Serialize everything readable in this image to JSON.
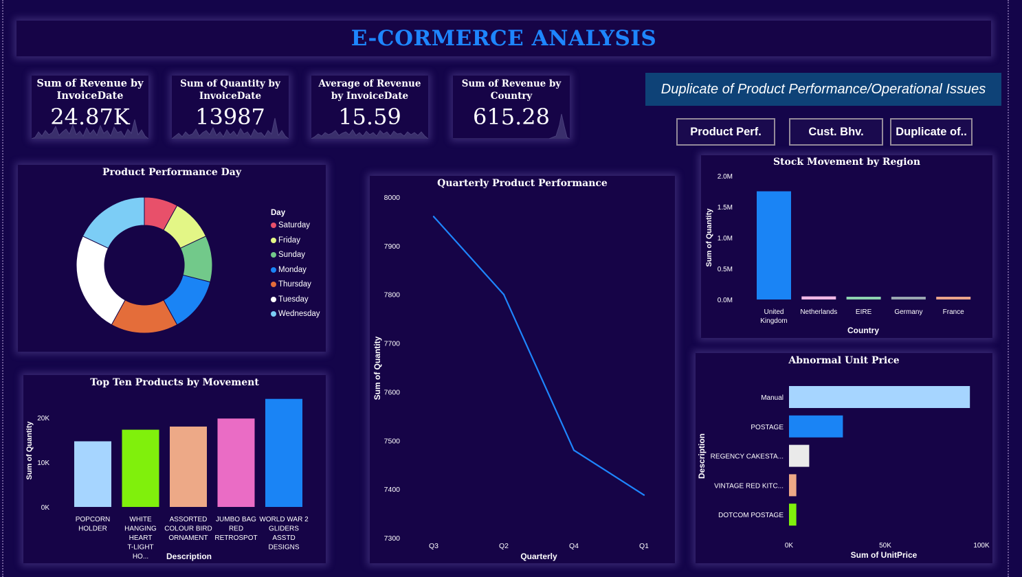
{
  "header": {
    "title": "E-CORMERCE ANALYSIS"
  },
  "kpis": [
    {
      "label": "Sum of Revenue by InvoiceDate",
      "value": "24.87K"
    },
    {
      "label": "Sum of Quantity by InvoiceDate",
      "value": "13987"
    },
    {
      "label": "Average of Revenue by InvoiceDate",
      "value": "15.59"
    },
    {
      "label": "Sum of Revenue by Country",
      "value": "615.28"
    }
  ],
  "banner": {
    "text": "Duplicate of  Product Performance/Operational Issues"
  },
  "nav": {
    "product_perf": "Product Perf.",
    "cust_bhv": "Cust. Bhv.",
    "duplicate": "Duplicate of.."
  },
  "colors": {
    "background": "#14054a",
    "panel": "#160447",
    "title": "#1e86ff",
    "banner": "#0e4277",
    "line": "#1e86ff"
  },
  "chart_data": [
    {
      "id": "donut",
      "type": "pie",
      "title": "Product Performance Day",
      "legend_title": "Day",
      "legend_position": "right",
      "categories": [
        "Saturday",
        "Friday",
        "Sunday",
        "Monday",
        "Thursday",
        "Tuesday",
        "Wednesday"
      ],
      "values": [
        8,
        10,
        11,
        13,
        16,
        24,
        18
      ],
      "colors": [
        "#e8506a",
        "#e3f686",
        "#72c98a",
        "#1a84f5",
        "#e46d3a",
        "#ffffff",
        "#7ccdf6"
      ]
    },
    {
      "id": "line",
      "type": "line",
      "title": "Quarterly Product Performance",
      "xlabel": "Quarterly",
      "ylabel": "Sum of Quantity",
      "categories": [
        "Q3",
        "Q2",
        "Q4",
        "Q1"
      ],
      "values": [
        7960,
        7800,
        7480,
        7388
      ],
      "ylim": [
        7300,
        8000
      ],
      "yticks": [
        "7300",
        "7400",
        "7500",
        "7600",
        "7700",
        "7800",
        "7900",
        "8000"
      ],
      "grid": false
    },
    {
      "id": "region",
      "type": "bar",
      "title": "Stock Movement by Region",
      "xlabel": "Country",
      "ylabel": "Sum of Quantity",
      "categories": [
        "United Kingdom",
        "Netherlands",
        "EIRE",
        "Germany",
        "France"
      ],
      "values": [
        1750000,
        50000,
        30000,
        30000,
        30000
      ],
      "ylim": [
        0,
        2000000
      ],
      "yticks": [
        "0.0M",
        "0.5M",
        "1.0M",
        "1.5M",
        "2.0M"
      ],
      "colors": [
        "#1a84f5",
        "#f1b7e6",
        "#8dd3b0",
        "#9aa7b1",
        "#eaa48a"
      ]
    },
    {
      "id": "top10",
      "type": "bar",
      "title": "Top Ten Products by Movement",
      "xlabel": "Description",
      "ylabel": "Sum of Quantity",
      "categories": [
        "POPCORN HOLDER",
        "WHITE HANGING HEART T-LIGHT HO...",
        "ASSORTED COLOUR BIRD ORNAMENT",
        "JUMBO BAG RED RETROSPOT",
        "WORLD WAR 2 GLIDERS ASSTD DESIGNS"
      ],
      "values": [
        14700,
        17300,
        18000,
        19800,
        24200
      ],
      "ylim": [
        0,
        25000
      ],
      "yticks": [
        "0K",
        "10K",
        "20K"
      ],
      "colors": [
        "#a6d5ff",
        "#80f00c",
        "#eda987",
        "#ea6cc5",
        "#1a84f5"
      ]
    },
    {
      "id": "abnormal",
      "type": "bar",
      "orientation": "horizontal",
      "title": "Abnormal Unit Price",
      "xlabel": "Sum of UnitPrice",
      "ylabel": "Description",
      "categories": [
        "Manual",
        "POSTAGE",
        "REGENCY CAKESTA...",
        "VINTAGE RED KITC...",
        "DOTCOM POSTAGE"
      ],
      "values": [
        94000,
        28000,
        10500,
        3800,
        3800
      ],
      "xlim": [
        0,
        100000
      ],
      "xticks": [
        "0K",
        "50K",
        "100K"
      ],
      "colors": [
        "#a6d5ff",
        "#1a84f5",
        "#eaeaea",
        "#eda987",
        "#80f00c"
      ]
    }
  ]
}
